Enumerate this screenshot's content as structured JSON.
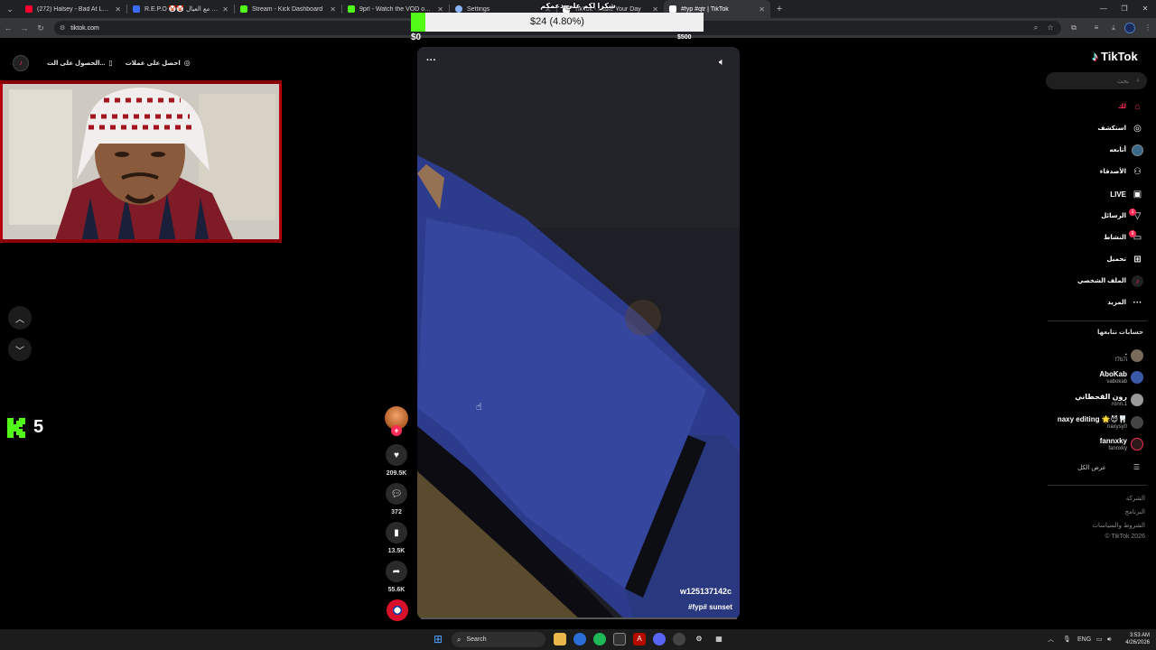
{
  "browser": {
    "tabs": [
      {
        "title": "(272) Halsey - Bad At Love",
        "color": "#ff0033",
        "active": false
      },
      {
        "title": "R.E.P.O 🤡🤡 حركاك !! مع العيال ! - Resta",
        "color": "#3b6cf5",
        "active": false
      },
      {
        "title": "Stream - Kick Dashboard",
        "color": "#53fc18",
        "active": false
      },
      {
        "title": "9prl - Watch the VOD on Kick",
        "color": "#53fc18",
        "active": false
      },
      {
        "title": "Settings",
        "color": "#8ab4f8",
        "active": false
      },
      {
        "title": "TikTok - Make Your Day",
        "color": "#ffffff",
        "active": false
      },
      {
        "title": "#fyp #qtr | TikTok",
        "color": "#ffffff",
        "active": true
      }
    ],
    "url": "tiktok.com"
  },
  "donation": {
    "title": "شكرا لكم على دعمكم",
    "text": "$24 (4.80%)",
    "min": "$0",
    "max": "$500",
    "progress_fraction": 0.048,
    "fill_color": "#53fc18"
  },
  "promo": {
    "item1": "احصل على عملات",
    "item2": "الحصول على الت..."
  },
  "kick": {
    "count": "5",
    "color": "#53fc18"
  },
  "video": {
    "author": "w125137142c",
    "caption": "#fyp# sunset",
    "menu": "···"
  },
  "actions": {
    "likes": "209.5K",
    "comments": "372",
    "saves": "13.5K",
    "shares": "55.6K"
  },
  "tiktok": {
    "brand": "TikTok",
    "search_placeholder": "بحث",
    "nav": [
      {
        "label": "لك",
        "icon": "home-icon",
        "active": true
      },
      {
        "label": "استكشف",
        "icon": "compass-icon"
      },
      {
        "label": "أتابعه",
        "icon": "avatar-icon"
      },
      {
        "label": "الأصدقاء",
        "icon": "friends-icon"
      },
      {
        "label": "LIVE",
        "icon": "live-icon"
      },
      {
        "label": "الرسائل",
        "icon": "send-icon",
        "badge": "1"
      },
      {
        "label": "النشاط",
        "icon": "activity-icon",
        "badge": "9"
      },
      {
        "label": "تحميل",
        "icon": "upload-icon"
      },
      {
        "label": "الملف الشخصي",
        "icon": "profile-icon"
      },
      {
        "label": "المزيد",
        "icon": "more-icon"
      }
    ],
    "following_title": "حسابات تتابعها",
    "following": [
      {
        "name": ".",
        "username": "f7b7i"
      },
      {
        "name": "AboKab",
        "username": "vabokab"
      },
      {
        "name": "رون القحطاني",
        "username": "ronn.1"
      },
      {
        "name": "naxy editing 🌟😈🦷",
        "username": "naxysy0"
      },
      {
        "name": "fannxky",
        "username": "fannxky"
      }
    ],
    "see_all": "عرض الكل",
    "footer": [
      "الشركة",
      "البرنامج",
      "الشروط والسياسات",
      "© TikTok 2026"
    ]
  },
  "taskbar": {
    "search": "Search",
    "lang": "ENG",
    "time": "3:53 AM",
    "date": "4/26/2026"
  }
}
